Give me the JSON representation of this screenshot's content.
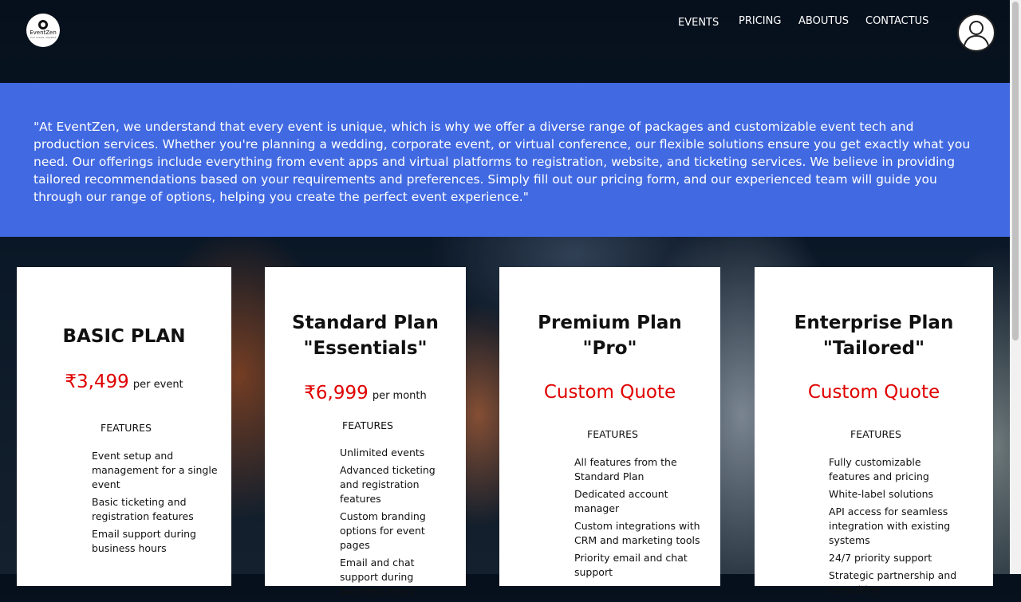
{
  "brand": {
    "name": "EventZen",
    "tagline": "Your events, elevated"
  },
  "nav": {
    "items": [
      {
        "label": "EVENTS",
        "active": true
      },
      {
        "label": "PRICING",
        "active": false
      },
      {
        "label": "ABOUTUS",
        "active": false
      },
      {
        "label": "CONTACTUS",
        "active": false
      }
    ]
  },
  "avatar": {
    "icon": "user-avatar-icon"
  },
  "banner": {
    "text": "\"At EventZen, we understand that every event is unique, which is why we offer a diverse range of packages and customizable event tech and production services. Whether you're planning a wedding, corporate event, or virtual conference, our flexible solutions ensure you get exactly what you need. Our offerings include everything from event apps and virtual platforms to registration, website, and ticketing services. We believe in providing tailored recommendations based on your requirements and preferences. Simply fill out our pricing form, and our experienced team will guide you through our range of options, helping you create the perfect event experience.\""
  },
  "plans": [
    {
      "title_line1": "BASIC PLAN",
      "title_line2": "",
      "price": "₹3,499",
      "per": "per event",
      "features_label": "FEATURES",
      "features": [
        "Event setup and management for a single event",
        "Basic ticketing and registration features",
        "Email support during business hours"
      ]
    },
    {
      "title_line1": "Standard Plan",
      "title_line2": "\"Essentials\"",
      "price": "₹6,999",
      "per": "per month",
      "features_label": "FEATURES",
      "features": [
        "Unlimited events",
        "Advanced ticketing and registration features",
        "Custom branding options for event pages",
        "Email and chat support during business hours"
      ]
    },
    {
      "title_line1": "Premium Plan",
      "title_line2": "\"Pro\"",
      "price": "Custom Quote",
      "per": "",
      "features_label": "FEATURES",
      "features": [
        "All features from the Standard Plan",
        "Dedicated account manager",
        "Custom integrations with CRM and marketing tools",
        "Priority email and chat support"
      ]
    },
    {
      "title_line1": "Enterprise Plan",
      "title_line2": "\"Tailored\"",
      "price": "Custom Quote",
      "per": "",
      "features_label": "FEATURES",
      "features": [
        "Fully customizable features and pricing",
        "White-label solutions",
        "API access for seamless integration with existing systems",
        "24/7 priority support",
        "Strategic partnership and consulting"
      ]
    }
  ],
  "colors": {
    "banner": "#4169e1",
    "price": "#e00000"
  }
}
